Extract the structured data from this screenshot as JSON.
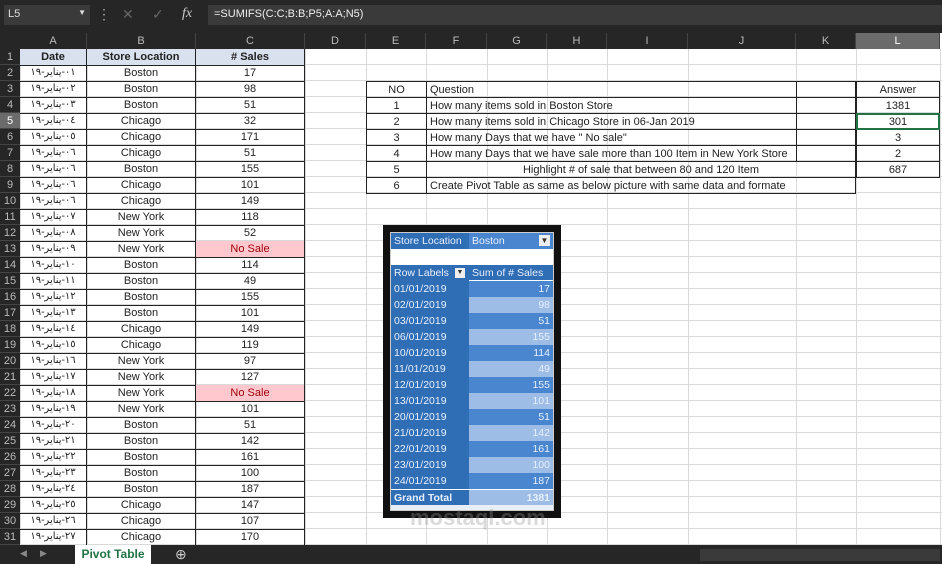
{
  "formula_bar": {
    "name_box": "L5",
    "formula": "=SUMIFS(C:C;B:B;P5;A:A;N5)",
    "cancel_icon": "✕",
    "enter_icon": "✓",
    "fx_icon": "fx"
  },
  "columns": [
    "A",
    "B",
    "C",
    "D",
    "E",
    "F",
    "G",
    "H",
    "I",
    "J",
    "K",
    "L"
  ],
  "selected_cell": {
    "column": "L",
    "row": 5
  },
  "data_table": {
    "headers": [
      "Date",
      "Store Location",
      "# Sales"
    ],
    "rows": [
      [
        "٠١-يناير-١٩",
        "Boston",
        "17"
      ],
      [
        "٠٢-يناير-١٩",
        "Boston",
        "98"
      ],
      [
        "٠٣-يناير-١٩",
        "Boston",
        "51"
      ],
      [
        "٠٤-يناير-١٩",
        "Chicago",
        "32"
      ],
      [
        "٠٥-يناير-١٩",
        "Chicago",
        "171"
      ],
      [
        "٠٦-يناير-١٩",
        "Chicago",
        "51"
      ],
      [
        "٠٦-يناير-١٩",
        "Boston",
        "155"
      ],
      [
        "٠٦-يناير-١٩",
        "Chicago",
        "101"
      ],
      [
        "٠٦-يناير-١٩",
        "Chicago",
        "149"
      ],
      [
        "٠٧-يناير-١٩",
        "New York",
        "118"
      ],
      [
        "٠٨-يناير-١٩",
        "New York",
        "52"
      ],
      [
        "٠٩-يناير-١٩",
        "New York",
        "No Sale"
      ],
      [
        "١٠-يناير-١٩",
        "Boston",
        "114"
      ],
      [
        "١١-يناير-١٩",
        "Boston",
        "49"
      ],
      [
        "١٢-يناير-١٩",
        "Boston",
        "155"
      ],
      [
        "١٣-يناير-١٩",
        "Boston",
        "101"
      ],
      [
        "١٤-يناير-١٩",
        "Chicago",
        "149"
      ],
      [
        "١٥-يناير-١٩",
        "Chicago",
        "119"
      ],
      [
        "١٦-يناير-١٩",
        "New York",
        "97"
      ],
      [
        "١٧-يناير-١٩",
        "New York",
        "127"
      ],
      [
        "١٨-يناير-١٩",
        "New York",
        "No Sale"
      ],
      [
        "١٩-يناير-١٩",
        "New York",
        "101"
      ],
      [
        "٢٠-يناير-١٩",
        "Boston",
        "51"
      ],
      [
        "٢١-يناير-١٩",
        "Boston",
        "142"
      ],
      [
        "٢٢-يناير-١٩",
        "Boston",
        "161"
      ],
      [
        "٢٣-يناير-١٩",
        "Boston",
        "100"
      ],
      [
        "٢٤-يناير-١٩",
        "Boston",
        "187"
      ],
      [
        "٢٥-يناير-١٩",
        "Chicago",
        "147"
      ],
      [
        "٢٦-يناير-١٩",
        "Chicago",
        "107"
      ],
      [
        "٢٧-يناير-١٩",
        "Chicago",
        "170"
      ]
    ]
  },
  "questions": {
    "header": {
      "no": "NO",
      "question": "Question",
      "answer": "Answer"
    },
    "rows": [
      {
        "no": "1",
        "question": "How many items sold in Boston Store",
        "answer": "1381"
      },
      {
        "no": "2",
        "question": "How many items sold in Chicago Store in 06-Jan 2019",
        "answer": "301"
      },
      {
        "no": "3",
        "question": "How many Days that we have \" No sale\"",
        "answer": "3"
      },
      {
        "no": "4",
        "question": "How many Days that we have sale more than 100 Item in New York Store",
        "answer": "2"
      },
      {
        "no": "5",
        "question": "Highlight # of sale that between 80 and 120 Item",
        "answer": "687"
      },
      {
        "no": "6",
        "question": "Create Pivot Table as same as below picture with same data and formate",
        "answer": ""
      }
    ]
  },
  "pivot": {
    "filter_label": "Store Location",
    "filter_value": "Boston",
    "row_labels": "Row Labels",
    "values_header": "Sum of # Sales",
    "rows": [
      [
        "01/01/2019",
        "17"
      ],
      [
        "02/01/2019",
        "98"
      ],
      [
        "03/01/2019",
        "51"
      ],
      [
        "06/01/2019",
        "155"
      ],
      [
        "10/01/2019",
        "114"
      ],
      [
        "11/01/2019",
        "49"
      ],
      [
        "12/01/2019",
        "155"
      ],
      [
        "13/01/2019",
        "101"
      ],
      [
        "20/01/2019",
        "51"
      ],
      [
        "21/01/2019",
        "142"
      ],
      [
        "22/01/2019",
        "161"
      ],
      [
        "23/01/2019",
        "100"
      ],
      [
        "24/01/2019",
        "187"
      ]
    ],
    "grand_total_label": "Grand Total",
    "grand_total": "1381",
    "colors": {
      "dark": "#2f6db5",
      "mid": "#4a86cf",
      "light": "#9dbde6"
    }
  },
  "sheet_tabs": [
    {
      "label": "Pivot Table",
      "active": true
    }
  ],
  "watermark": "mostaql.com"
}
